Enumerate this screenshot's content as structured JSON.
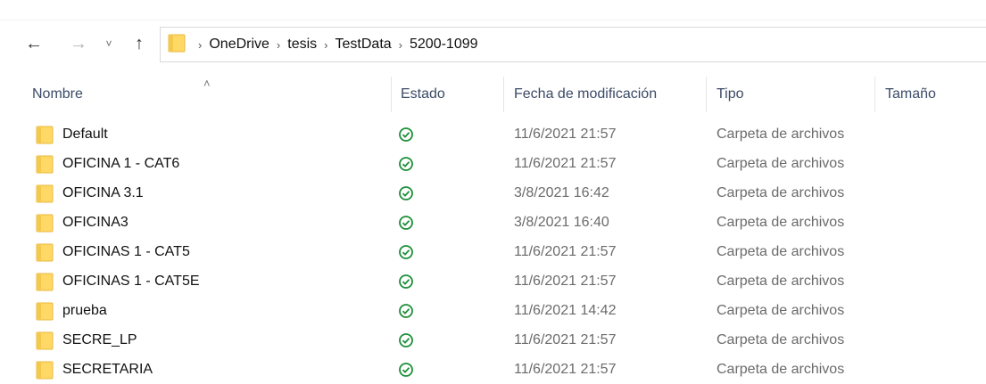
{
  "nav": {
    "back_icon": "←",
    "forward_icon": "→",
    "recent_icon": "˅",
    "up_icon": "↑",
    "breadcrumb": [
      "OneDrive",
      "tesis",
      "TestData",
      "5200-1099"
    ],
    "separator": "›"
  },
  "columns": {
    "name": "Nombre",
    "status": "Estado",
    "modified": "Fecha de modificación",
    "type": "Tipo",
    "size": "Tamaño"
  },
  "sort_caret": "˄",
  "colors": {
    "folder_fill": "#FFD866",
    "folder_dark": "#E8B93E",
    "sync_green": "#1e8f3a",
    "header_text": "#3b4a66"
  },
  "files": [
    {
      "name": "Default",
      "modified": "11/6/2021 21:57",
      "type": "Carpeta de archivos",
      "status": "synced-icon"
    },
    {
      "name": "OFICINA 1 - CAT6",
      "modified": "11/6/2021 21:57",
      "type": "Carpeta de archivos",
      "status": "synced-icon"
    },
    {
      "name": "OFICINA 3.1",
      "modified": "3/8/2021 16:42",
      "type": "Carpeta de archivos",
      "status": "synced-icon"
    },
    {
      "name": "OFICINA3",
      "modified": "3/8/2021 16:40",
      "type": "Carpeta de archivos",
      "status": "synced-icon"
    },
    {
      "name": "OFICINAS 1 - CAT5",
      "modified": "11/6/2021 21:57",
      "type": "Carpeta de archivos",
      "status": "synced-icon"
    },
    {
      "name": "OFICINAS 1 - CAT5E",
      "modified": "11/6/2021 21:57",
      "type": "Carpeta de archivos",
      "status": "synced-icon"
    },
    {
      "name": "prueba",
      "modified": "11/6/2021 14:42",
      "type": "Carpeta de archivos",
      "status": "synced-icon"
    },
    {
      "name": "SECRE_LP",
      "modified": "11/6/2021 21:57",
      "type": "Carpeta de archivos",
      "status": "synced-icon"
    },
    {
      "name": "SECRETARIA",
      "modified": "11/6/2021 21:57",
      "type": "Carpeta de archivos",
      "status": "synced-icon"
    }
  ]
}
